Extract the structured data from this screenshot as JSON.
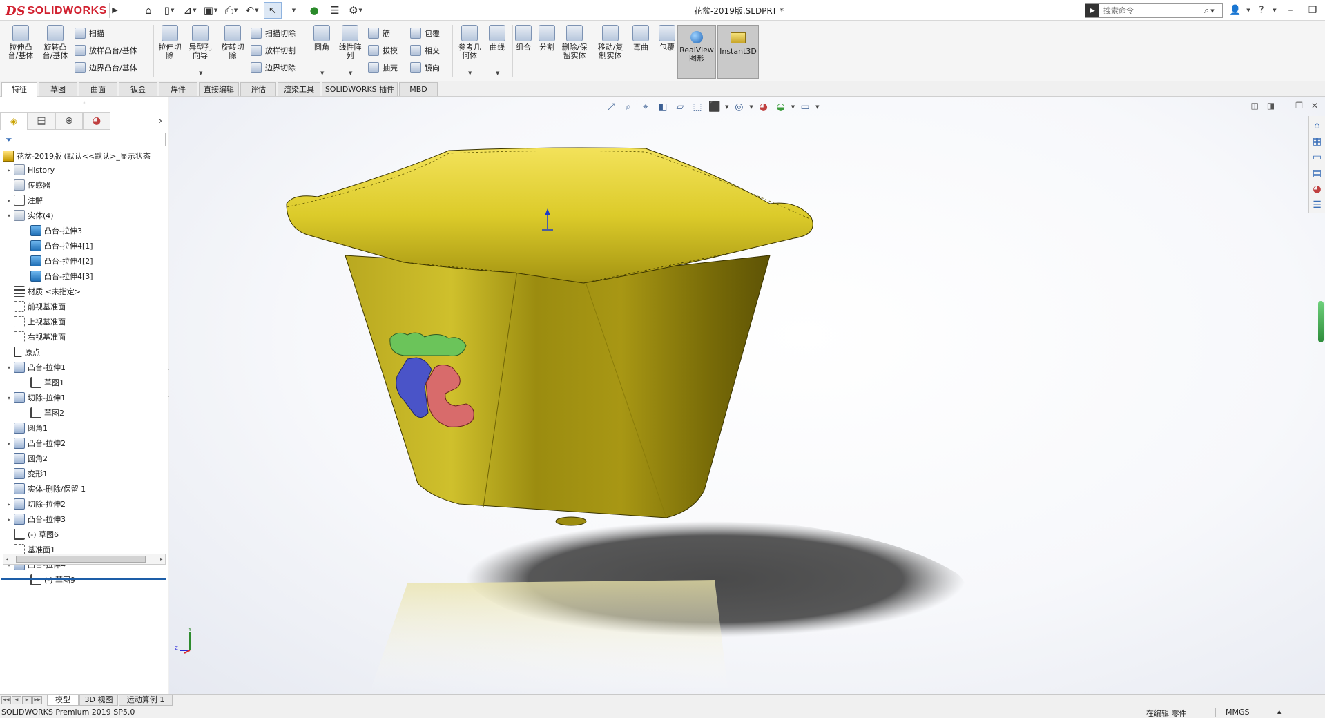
{
  "app": {
    "logo_ds": "DS",
    "logo_name": "SOLIDWORKS",
    "doc_title": "花盆-2019版.SLDPRT *"
  },
  "search": {
    "placeholder": "搜索命令"
  },
  "ribbon": {
    "extrude_boss": "拉伸凸\n台/基体",
    "revolve_boss": "旋转凸\n台/基体",
    "sweep": "扫描",
    "loft_boss": "放样凸台/基体",
    "boundary_boss": "边界凸台/基体",
    "extrude_cut": "拉伸切\n除",
    "hole_wizard": "异型孔\n向导",
    "revolve_cut": "旋转切\n除",
    "sweep_cut": "扫描切除",
    "loft_cut": "放样切割",
    "boundary_cut": "边界切除",
    "fillet": "圆角",
    "linear_pattern": "线性阵\n列",
    "rib": "筋",
    "draft": "拔模",
    "shell": "抽壳",
    "wrap": "包覆",
    "intersect": "相交",
    "mirror": "镜向",
    "ref_geometry": "参考几\n何体",
    "curves": "曲线",
    "combine": "组合",
    "split": "分割",
    "delete_keep_body": "删除/保\n留实体",
    "move_copy_body": "移动/复\n制实体",
    "flex": "弯曲",
    "wrap2": "包覆",
    "realview": "RealView\n图形",
    "instant3d": "Instant3D"
  },
  "cmd_tabs": [
    "特征",
    "草图",
    "曲面",
    "钣金",
    "焊件",
    "直接编辑",
    "评估",
    "渲染工具",
    "SOLIDWORKS 插件",
    "MBD"
  ],
  "feature_manager": {
    "root": "花盆-2019版 (默认<<默认>_显示状态",
    "tree": [
      {
        "label": "History",
        "icon": "folder-icon",
        "arrow": "▸",
        "indent": 0
      },
      {
        "label": "传感器",
        "icon": "sensor-icon",
        "arrow": "",
        "indent": 0
      },
      {
        "label": "注解",
        "icon": "annotation-icon",
        "arrow": "▸",
        "indent": 0
      },
      {
        "label": "实体(4)",
        "icon": "solid-bodies-icon",
        "arrow": "▾",
        "indent": 0
      },
      {
        "label": "凸台-拉伸3",
        "icon": "body-icon",
        "arrow": "",
        "indent": 1
      },
      {
        "label": "凸台-拉伸4[1]",
        "icon": "body-icon",
        "arrow": "",
        "indent": 1
      },
      {
        "label": "凸台-拉伸4[2]",
        "icon": "body-icon",
        "arrow": "",
        "indent": 1
      },
      {
        "label": "凸台-拉伸4[3]",
        "icon": "body-icon",
        "arrow": "",
        "indent": 1
      },
      {
        "label": "材质 <未指定>",
        "icon": "material-icon",
        "arrow": "",
        "indent": 0
      },
      {
        "label": "前视基准面",
        "icon": "plane-icon",
        "arrow": "",
        "indent": 0
      },
      {
        "label": "上视基准面",
        "icon": "plane-icon",
        "arrow": "",
        "indent": 0
      },
      {
        "label": "右视基准面",
        "icon": "plane-icon",
        "arrow": "",
        "indent": 0
      },
      {
        "label": "原点",
        "icon": "origin-icon",
        "arrow": "",
        "indent": 0
      },
      {
        "label": "凸台-拉伸1",
        "icon": "extrude-icon",
        "arrow": "▾",
        "indent": 0
      },
      {
        "label": "草图1",
        "icon": "sketch-icon",
        "arrow": "",
        "indent": 1
      },
      {
        "label": "切除-拉伸1",
        "icon": "cut-extrude-icon",
        "arrow": "▾",
        "indent": 0
      },
      {
        "label": "草图2",
        "icon": "sketch-icon",
        "arrow": "",
        "indent": 1
      },
      {
        "label": "圆角1",
        "icon": "fillet-icon",
        "arrow": "",
        "indent": 0
      },
      {
        "label": "凸台-拉伸2",
        "icon": "extrude-icon",
        "arrow": "▸",
        "indent": 0
      },
      {
        "label": "圆角2",
        "icon": "fillet-icon",
        "arrow": "",
        "indent": 0
      },
      {
        "label": "变形1",
        "icon": "deform-icon",
        "arrow": "",
        "indent": 0
      },
      {
        "label": "实体-删除/保留 1",
        "icon": "delete-body-icon",
        "arrow": "",
        "indent": 0
      },
      {
        "label": "切除-拉伸2",
        "icon": "cut-extrude-icon",
        "arrow": "▸",
        "indent": 0
      },
      {
        "label": "凸台-拉伸3",
        "icon": "extrude-icon",
        "arrow": "▸",
        "indent": 0
      },
      {
        "label": "(-) 草图6",
        "icon": "sketch-icon",
        "arrow": "",
        "indent": 0
      },
      {
        "label": "基准面1",
        "icon": "plane-icon",
        "arrow": "",
        "indent": 0
      },
      {
        "label": "凸台-拉伸4",
        "icon": "extrude-icon",
        "arrow": "▾",
        "indent": 0
      },
      {
        "label": "(-) 草图9",
        "icon": "sketch-icon",
        "arrow": "",
        "indent": 1
      }
    ]
  },
  "bottom_tabs": [
    "模型",
    "3D 视图",
    "运动算例 1"
  ],
  "status": {
    "product": "SOLIDWORKS Premium 2019 SP5.0",
    "editing": "在编辑 零件",
    "units": "MMGS"
  },
  "colors": {
    "brand_red": "#d1202f",
    "pot_yellow": "#d4c21f",
    "char_green": "#6bc45a",
    "char_blue": "#4a54c8",
    "char_red": "#d86b6b"
  }
}
